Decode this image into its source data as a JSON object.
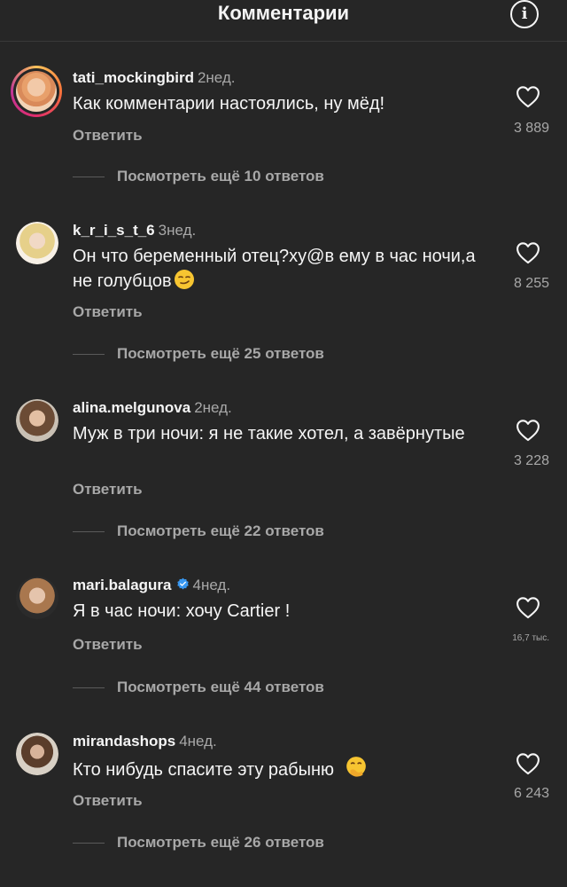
{
  "header": {
    "title": "Комментарии",
    "info_icon": "info-icon"
  },
  "colors": {
    "background": "#262626",
    "text": "#f5f5f5",
    "muted": "#a8a8a8",
    "verified": "#3897f0"
  },
  "comments": [
    {
      "username": "tati_mockingbird",
      "time": "2нед.",
      "text": "Как комментарии настоялись, ну мёд!",
      "reply_label": "Ответить",
      "likes": "3 889",
      "view_replies": "Посмотреть ещё 10 ответов",
      "has_story_ring": true
    },
    {
      "username": "k_r_i_s_t_6",
      "time": "3нед.",
      "text": "Он что беременный отец?ху@в ему в час ночи,а не голубцов",
      "emoji": "smirking-face-emoji",
      "reply_label": "Ответить",
      "likes": "8 255",
      "view_replies": "Посмотреть ещё 25 ответов"
    },
    {
      "username": "alina.melgunova",
      "time": "2нед.",
      "text": "Муж в три ночи: я не такие хотел, а завёрнутые",
      "reply_label": "Ответить",
      "likes": "3 228",
      "view_replies": "Посмотреть ещё 22 ответов"
    },
    {
      "username": "mari.balagura",
      "verified": true,
      "time": "4нед.",
      "text": "Я в час ночи: хочу Cartier !",
      "reply_label": "Ответить",
      "likes": "16,7 тыс.",
      "view_replies": "Посмотреть ещё 44 ответов"
    },
    {
      "username": "mirandashops",
      "time": "4нед.",
      "text": "Кто нибудь спасите эту рабыню",
      "emoji": "face-with-hand-over-mouth-emoji",
      "reply_label": "Ответить",
      "likes": "6 243",
      "view_replies": "Посмотреть ещё 26 ответов"
    }
  ]
}
